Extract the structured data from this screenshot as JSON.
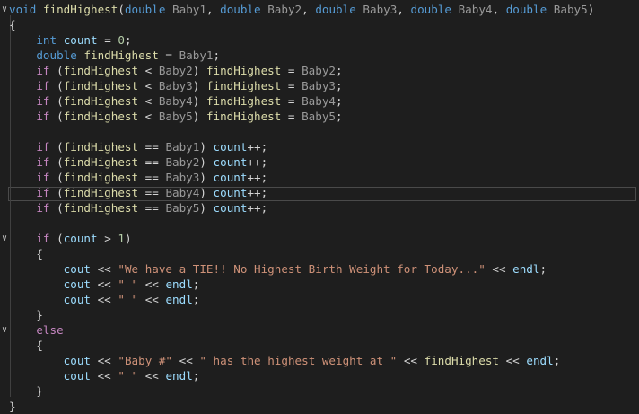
{
  "editor": {
    "lines": [
      [
        [
          "kw",
          "void"
        ],
        [
          "op",
          " "
        ],
        [
          "fn",
          "findHighest"
        ],
        [
          "op",
          "("
        ],
        [
          "kw",
          "double"
        ],
        [
          "op",
          " "
        ],
        [
          "prm",
          "Baby1"
        ],
        [
          "op",
          ", "
        ],
        [
          "kw",
          "double"
        ],
        [
          "op",
          " "
        ],
        [
          "prm",
          "Baby2"
        ],
        [
          "op",
          ", "
        ],
        [
          "kw",
          "double"
        ],
        [
          "op",
          " "
        ],
        [
          "prm",
          "Baby3"
        ],
        [
          "op",
          ", "
        ],
        [
          "kw",
          "double"
        ],
        [
          "op",
          " "
        ],
        [
          "prm",
          "Baby4"
        ],
        [
          "op",
          ", "
        ],
        [
          "kw",
          "double"
        ],
        [
          "op",
          " "
        ],
        [
          "prm",
          "Baby5"
        ],
        [
          "op",
          ")"
        ]
      ],
      [
        [
          "op",
          "{"
        ]
      ],
      [
        [
          "op",
          "    "
        ],
        [
          "kw",
          "int"
        ],
        [
          "op",
          " "
        ],
        [
          "var",
          "count"
        ],
        [
          "op",
          " = "
        ],
        [
          "num",
          "0"
        ],
        [
          "op",
          ";"
        ]
      ],
      [
        [
          "op",
          "    "
        ],
        [
          "kw",
          "double"
        ],
        [
          "op",
          " "
        ],
        [
          "fn",
          "findHighest"
        ],
        [
          "op",
          " = "
        ],
        [
          "prm",
          "Baby1"
        ],
        [
          "op",
          ";"
        ]
      ],
      [
        [
          "op",
          "    "
        ],
        [
          "ctl",
          "if"
        ],
        [
          "op",
          " ("
        ],
        [
          "fn",
          "findHighest"
        ],
        [
          "op",
          " < "
        ],
        [
          "prm",
          "Baby2"
        ],
        [
          "op",
          ") "
        ],
        [
          "fn",
          "findHighest"
        ],
        [
          "op",
          " = "
        ],
        [
          "prm",
          "Baby2"
        ],
        [
          "op",
          ";"
        ]
      ],
      [
        [
          "op",
          "    "
        ],
        [
          "ctl",
          "if"
        ],
        [
          "op",
          " ("
        ],
        [
          "fn",
          "findHighest"
        ],
        [
          "op",
          " < "
        ],
        [
          "prm",
          "Baby3"
        ],
        [
          "op",
          ") "
        ],
        [
          "fn",
          "findHighest"
        ],
        [
          "op",
          " = "
        ],
        [
          "prm",
          "Baby3"
        ],
        [
          "op",
          ";"
        ]
      ],
      [
        [
          "op",
          "    "
        ],
        [
          "ctl",
          "if"
        ],
        [
          "op",
          " ("
        ],
        [
          "fn",
          "findHighest"
        ],
        [
          "op",
          " < "
        ],
        [
          "prm",
          "Baby4"
        ],
        [
          "op",
          ") "
        ],
        [
          "fn",
          "findHighest"
        ],
        [
          "op",
          " = "
        ],
        [
          "prm",
          "Baby4"
        ],
        [
          "op",
          ";"
        ]
      ],
      [
        [
          "op",
          "    "
        ],
        [
          "ctl",
          "if"
        ],
        [
          "op",
          " ("
        ],
        [
          "fn",
          "findHighest"
        ],
        [
          "op",
          " < "
        ],
        [
          "prm",
          "Baby5"
        ],
        [
          "op",
          ") "
        ],
        [
          "fn",
          "findHighest"
        ],
        [
          "op",
          " = "
        ],
        [
          "prm",
          "Baby5"
        ],
        [
          "op",
          ";"
        ]
      ],
      [],
      [
        [
          "op",
          "    "
        ],
        [
          "ctl",
          "if"
        ],
        [
          "op",
          " ("
        ],
        [
          "fn",
          "findHighest"
        ],
        [
          "op",
          " == "
        ],
        [
          "prm",
          "Baby1"
        ],
        [
          "op",
          ") "
        ],
        [
          "var",
          "count"
        ],
        [
          "op",
          "++;"
        ]
      ],
      [
        [
          "op",
          "    "
        ],
        [
          "ctl",
          "if"
        ],
        [
          "op",
          " ("
        ],
        [
          "fn",
          "findHighest"
        ],
        [
          "op",
          " == "
        ],
        [
          "prm",
          "Baby2"
        ],
        [
          "op",
          ") "
        ],
        [
          "var",
          "count"
        ],
        [
          "op",
          "++;"
        ]
      ],
      [
        [
          "op",
          "    "
        ],
        [
          "ctl",
          "if"
        ],
        [
          "op",
          " ("
        ],
        [
          "fn",
          "findHighest"
        ],
        [
          "op",
          " == "
        ],
        [
          "prm",
          "Baby3"
        ],
        [
          "op",
          ") "
        ],
        [
          "var",
          "count"
        ],
        [
          "op",
          "++;"
        ]
      ],
      [
        [
          "op",
          "    "
        ],
        [
          "ctl",
          "if"
        ],
        [
          "op",
          " ("
        ],
        [
          "fn",
          "findHighest"
        ],
        [
          "op",
          " == "
        ],
        [
          "prm",
          "Baby4"
        ],
        [
          "op",
          ") "
        ],
        [
          "var",
          "count"
        ],
        [
          "op",
          "++;"
        ]
      ],
      [
        [
          "op",
          "    "
        ],
        [
          "ctl",
          "if"
        ],
        [
          "op",
          " ("
        ],
        [
          "fn",
          "findHighest"
        ],
        [
          "op",
          " == "
        ],
        [
          "prm",
          "Baby5"
        ],
        [
          "op",
          ") "
        ],
        [
          "var",
          "count"
        ],
        [
          "op",
          "++;"
        ]
      ],
      [],
      [
        [
          "op",
          "    "
        ],
        [
          "ctl",
          "if"
        ],
        [
          "op",
          " ("
        ],
        [
          "var",
          "count"
        ],
        [
          "op",
          " > "
        ],
        [
          "num",
          "1"
        ],
        [
          "op",
          ")"
        ]
      ],
      [
        [
          "op",
          "    {"
        ]
      ],
      [
        [
          "op",
          "        "
        ],
        [
          "var",
          "cout"
        ],
        [
          "op",
          " << "
        ],
        [
          "str",
          "\"We have a TIE!! No Highest Birth Weight for Today...\""
        ],
        [
          "op",
          " << "
        ],
        [
          "var",
          "endl"
        ],
        [
          "op",
          ";"
        ]
      ],
      [
        [
          "op",
          "        "
        ],
        [
          "var",
          "cout"
        ],
        [
          "op",
          " << "
        ],
        [
          "str",
          "\" \""
        ],
        [
          "op",
          " << "
        ],
        [
          "var",
          "endl"
        ],
        [
          "op",
          ";"
        ]
      ],
      [
        [
          "op",
          "        "
        ],
        [
          "var",
          "cout"
        ],
        [
          "op",
          " << "
        ],
        [
          "str",
          "\" \""
        ],
        [
          "op",
          " << "
        ],
        [
          "var",
          "endl"
        ],
        [
          "op",
          ";"
        ]
      ],
      [
        [
          "op",
          "    }"
        ]
      ],
      [
        [
          "op",
          "    "
        ],
        [
          "ctl",
          "else"
        ]
      ],
      [
        [
          "op",
          "    {"
        ]
      ],
      [
        [
          "op",
          "        "
        ],
        [
          "var",
          "cout"
        ],
        [
          "op",
          " << "
        ],
        [
          "str",
          "\"Baby #\""
        ],
        [
          "op",
          " << "
        ],
        [
          "str",
          "\" has the highest weight at \""
        ],
        [
          "op",
          " << "
        ],
        [
          "fn",
          "findHighest"
        ],
        [
          "op",
          " << "
        ],
        [
          "var",
          "endl"
        ],
        [
          "op",
          ";"
        ]
      ],
      [
        [
          "op",
          "        "
        ],
        [
          "var",
          "cout"
        ],
        [
          "op",
          " << "
        ],
        [
          "str",
          "\" \""
        ],
        [
          "op",
          " << "
        ],
        [
          "var",
          "endl"
        ],
        [
          "op",
          ";"
        ]
      ],
      [
        [
          "op",
          "    }"
        ]
      ],
      [
        [
          "op",
          "}"
        ]
      ]
    ],
    "fold_rows": [
      0,
      15,
      21
    ]
  }
}
